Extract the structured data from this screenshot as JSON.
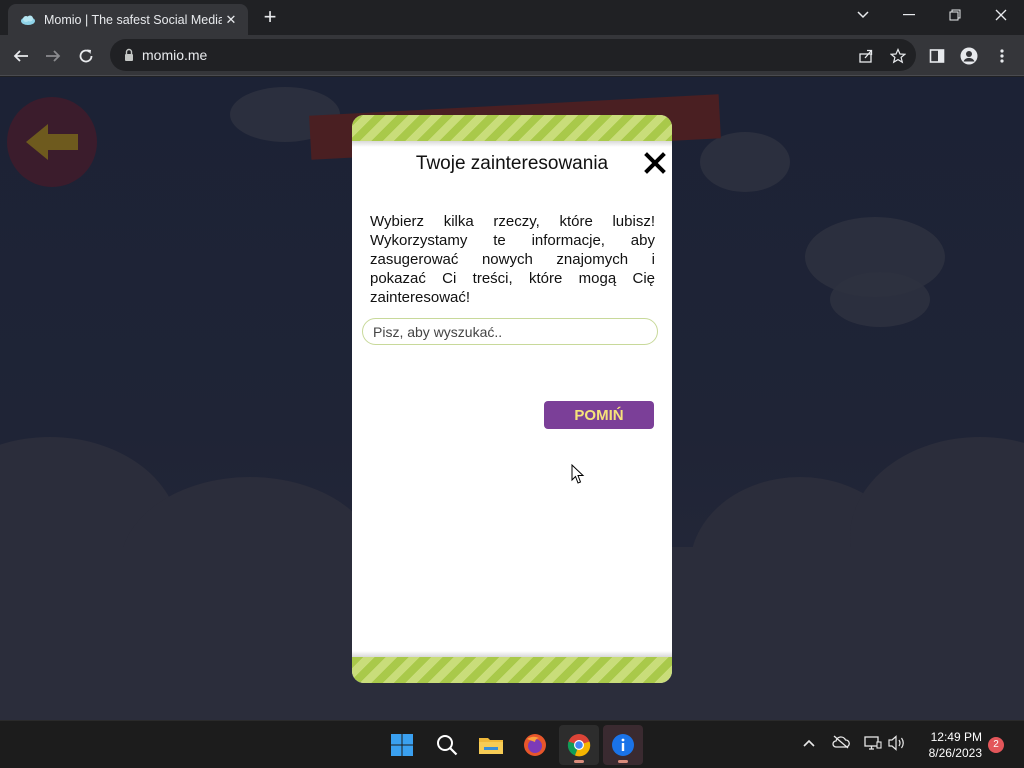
{
  "browser": {
    "tab_title": "Momio | The safest Social Media",
    "tab_close": "✕",
    "new_tab": "+",
    "url": "momio.me"
  },
  "modal": {
    "title": "Twoje zainteresowania",
    "description": "Wybierz kilka rzeczy, które lubisz! Wykorzystamy te informacje, aby zasugerować nowych znajomych i pokazać Ci treści, które mogą Cię zainteresować!",
    "search_placeholder": "Pisz, aby wyszukać..",
    "skip_label": "POMIŃ"
  },
  "taskbar": {
    "time": "12:49 PM",
    "date": "8/26/2023",
    "notification_count": "2"
  },
  "colors": {
    "stripe_green": "#a9c94a",
    "skip_button": "#7b3f98",
    "skip_text": "#f6e27a"
  }
}
